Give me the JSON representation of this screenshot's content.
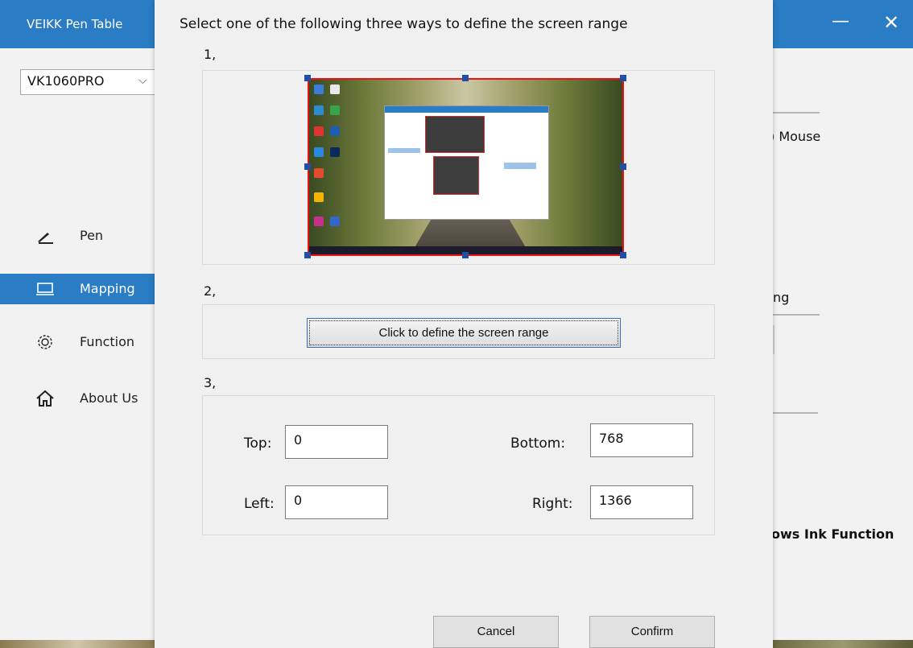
{
  "app": {
    "title": "VEIKK Pen Table",
    "minimize_symbol": "—",
    "close_symbol": "✕",
    "model": "VK1060PRO",
    "model_chevron": "⌵",
    "nav": [
      {
        "label": "Pen",
        "icon": "pen-icon"
      },
      {
        "label": "Mapping",
        "icon": "monitor-icon"
      },
      {
        "label": "Function",
        "icon": "gear-icon"
      },
      {
        "label": "About Us",
        "icon": "home-icon"
      }
    ],
    "right_fragments": {
      "mouse_option": ") Mouse",
      "mapping_fragment": "ng",
      "windows_ink_fragment": "ows Ink Function"
    }
  },
  "dialog": {
    "heading": "Select one of the following three ways to define the screen range",
    "step1_label": "1,",
    "step2_label": "2,",
    "step3_label": "3,",
    "define_button": "Click to define the screen range",
    "fields": {
      "top_label": "Top:",
      "top_value": "0",
      "bottom_label": "Bottom:",
      "bottom_value": "768",
      "left_label": "Left:",
      "left_value": "0",
      "right_label": "Right:",
      "right_value": "1366"
    },
    "cancel_label": "Cancel",
    "confirm_label": "Confirm"
  },
  "colors": {
    "titlebar": "#2a7cc4",
    "nav_active": "#2a7cc4",
    "preview_border": "#ee1111"
  }
}
